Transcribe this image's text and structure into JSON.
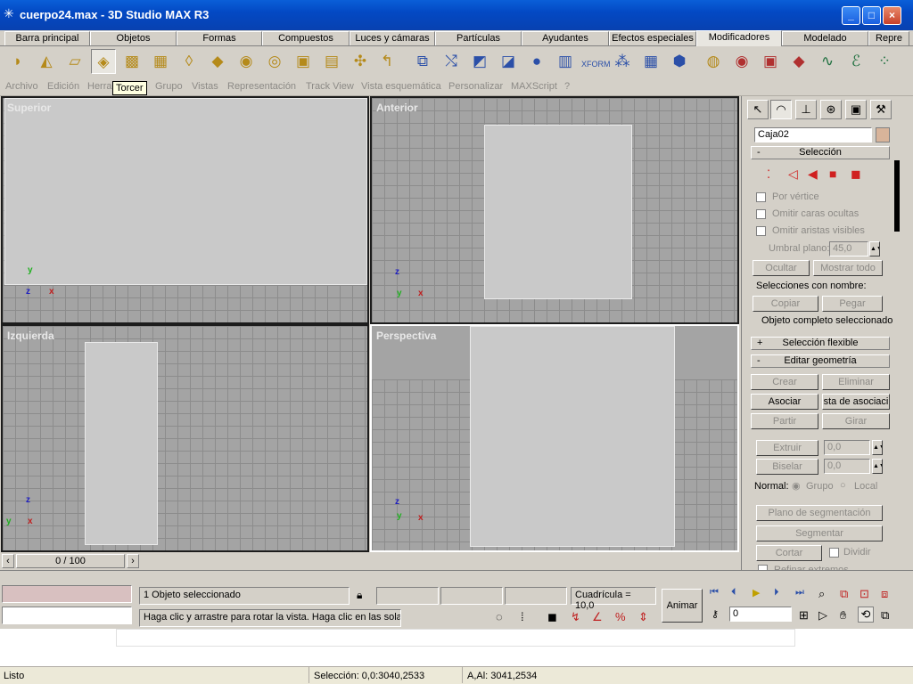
{
  "window": {
    "title": "cuerpo24.max - 3D Studio MAX R3"
  },
  "tabs": [
    "Barra principal",
    "Objetos",
    "Formas",
    "Compuestos",
    "Luces y cámaras",
    "Partículas",
    "Ayudantes",
    "Efectos especiales",
    "Modificadores",
    "Modelado",
    "Repre"
  ],
  "active_tab": "Modificadores",
  "menu": [
    "Archivo",
    "Edición",
    "Herra",
    "Grupo",
    "Vistas",
    "Representación",
    "Track View",
    "Vista esquemática",
    "Personalizar",
    "MAXScript",
    "?"
  ],
  "tooltip": "Torcer",
  "viewports": {
    "top": {
      "label": "Superior",
      "axes": {
        "x": "x",
        "y": "y",
        "z": "z"
      }
    },
    "front": {
      "label": "Anterior",
      "axes": {
        "x": "x",
        "y": "y",
        "z": "z"
      }
    },
    "left": {
      "label": "Izquierda",
      "axes": {
        "x": "x",
        "y": "y",
        "z": "z"
      }
    },
    "persp": {
      "label": "Perspectiva",
      "axes": {
        "x": "x",
        "y": "y",
        "z": "z"
      }
    }
  },
  "command_panel": {
    "object_name": "Caja02",
    "object_color": "#d8b49a",
    "rollouts": {
      "seleccion": "Selección",
      "seleccion_flexible": "Selección flexible",
      "editar_geometria": "Editar geometría"
    },
    "selection": {
      "por_vertice": "Por vértice",
      "omitir_caras": "Omitir caras ocultas",
      "omitir_aristas": "Omitir aristas visibles",
      "umbral_label": "Umbral plano:",
      "umbral_value": "45,0",
      "ocultar": "Ocultar",
      "mostrar_todo": "Mostrar todo",
      "selecciones_label": "Selecciones con nombre:",
      "copiar": "Copiar",
      "pegar": "Pegar",
      "status": "Objeto completo seleccionado"
    },
    "geometry": {
      "crear": "Crear",
      "eliminar": "Eliminar",
      "asociar": "Asociar",
      "asociar_lista": "sta de asociaci",
      "partir": "Partir",
      "girar": "Girar",
      "extruir": "Extruir",
      "extruir_val": "0,0",
      "biselar": "Biselar",
      "biselar_val": "0,0",
      "normal_label": "Normal:",
      "grupo": "Grupo",
      "local": "Local",
      "plano_seg": "Plano de segmentación",
      "segmentar": "Segmentar",
      "cortar": "Cortar",
      "dividir": "Dividir",
      "refinar": "Refinar extremos"
    }
  },
  "timeline": {
    "frame": "0 / 100"
  },
  "status": {
    "selected": "1 Objeto seleccionado",
    "prompt": "Haga clic y arrastre para rotar la vista. Haga clic en las solap",
    "grid": "Cuadrícula = 10,0",
    "animate": "Animar",
    "frame_field": "0"
  },
  "os_status": {
    "ready": "Listo",
    "selection": "Selección: 0,0:3040,2533",
    "aal": "A,Al: 3041,2534"
  }
}
